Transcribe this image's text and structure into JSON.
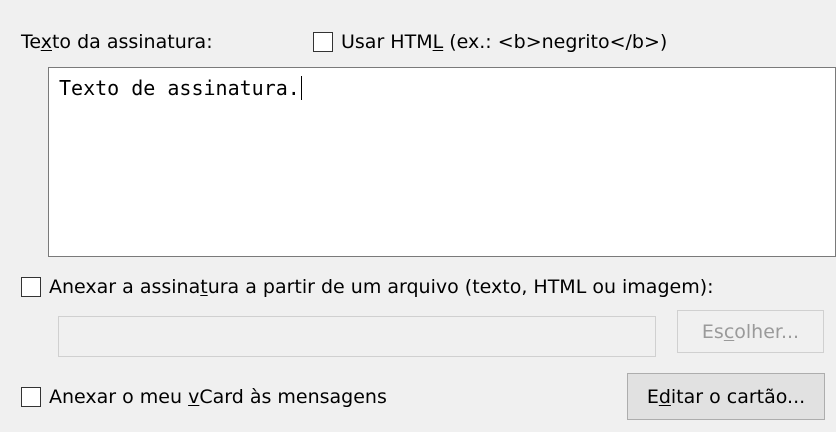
{
  "signature_label": {
    "before": "Te",
    "accel": "x",
    "after": "to da assinatura:"
  },
  "use_html": {
    "checked": false,
    "before": "Usar HTM",
    "accel": "L",
    "after": " (ex.: <b>negrito</b>)"
  },
  "signature_text": "Texto de assinatura.",
  "attach_file": {
    "checked": false,
    "before": "Anexar a assina",
    "accel": "t",
    "after": "ura a partir de um arquivo (texto, HTML ou imagem):"
  },
  "file_path_value": "",
  "choose_button": {
    "before": "Es",
    "accel": "c",
    "after": "olher...",
    "enabled": false
  },
  "attach_vcard": {
    "checked": false,
    "before": "Anexar o meu ",
    "accel": "v",
    "after": "Card às mensagens"
  },
  "edit_card_button": {
    "before": "E",
    "accel": "d",
    "after": "itar o cartão..."
  }
}
